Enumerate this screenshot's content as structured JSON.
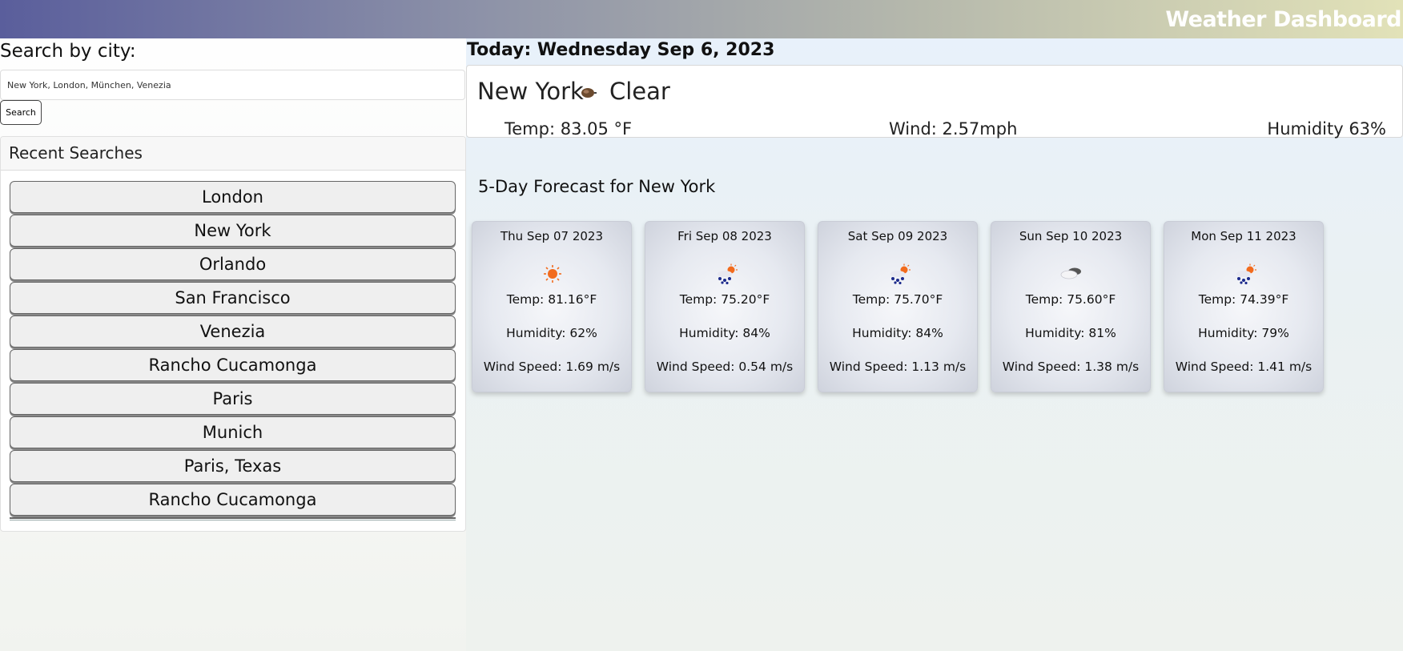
{
  "header": {
    "title": "Weather Dashboard"
  },
  "search": {
    "label": "Search by city:",
    "value": "New York, London, München, Venezia",
    "button_label": "Search"
  },
  "recent": {
    "title": "Recent Searches",
    "items": [
      {
        "label": "London"
      },
      {
        "label": "New York"
      },
      {
        "label": "Orlando"
      },
      {
        "label": "San Francisco"
      },
      {
        "label": "Venezia"
      },
      {
        "label": "Rancho Cucamonga"
      },
      {
        "label": "Paris"
      },
      {
        "label": "Munich"
      },
      {
        "label": "Paris, Texas"
      },
      {
        "label": "Rancho Cucamonga"
      }
    ]
  },
  "today": {
    "label": "Today: Wednesday Sep 6, 2023",
    "city": "New York",
    "condition": "Clear",
    "condition_icon": "clear-night-icon",
    "temp": "Temp: 83.05 °F",
    "wind": "Wind: 2.57mph",
    "humidity": "Humidity 63%"
  },
  "forecast": {
    "title": "5-Day Forecast for New York",
    "days": [
      {
        "date": "Thu Sep 07 2023",
        "icon": "sunny-icon",
        "temp": "Temp: 81.16°F",
        "humidity": "Humidity: 62%",
        "wind": "Wind Speed: 1.69 m/s"
      },
      {
        "date": "Fri Sep 08 2023",
        "icon": "sun-rain-icon",
        "temp": "Temp: 75.20°F",
        "humidity": "Humidity: 84%",
        "wind": "Wind Speed: 0.54 m/s"
      },
      {
        "date": "Sat Sep 09 2023",
        "icon": "sun-rain-icon",
        "temp": "Temp: 75.70°F",
        "humidity": "Humidity: 84%",
        "wind": "Wind Speed: 1.13 m/s"
      },
      {
        "date": "Sun Sep 10 2023",
        "icon": "cloudy-icon",
        "temp": "Temp: 75.60°F",
        "humidity": "Humidity: 81%",
        "wind": "Wind Speed: 1.38 m/s"
      },
      {
        "date": "Mon Sep 11 2023",
        "icon": "sun-rain-icon",
        "temp": "Temp: 74.39°F",
        "humidity": "Humidity: 79%",
        "wind": "Wind Speed: 1.41 m/s"
      }
    ]
  },
  "colors": {
    "header_gradient_start": "#5a5e9c",
    "header_gradient_end": "#e2e2b8",
    "sun": "#f26b1d",
    "rain": "#1c2a8c"
  }
}
